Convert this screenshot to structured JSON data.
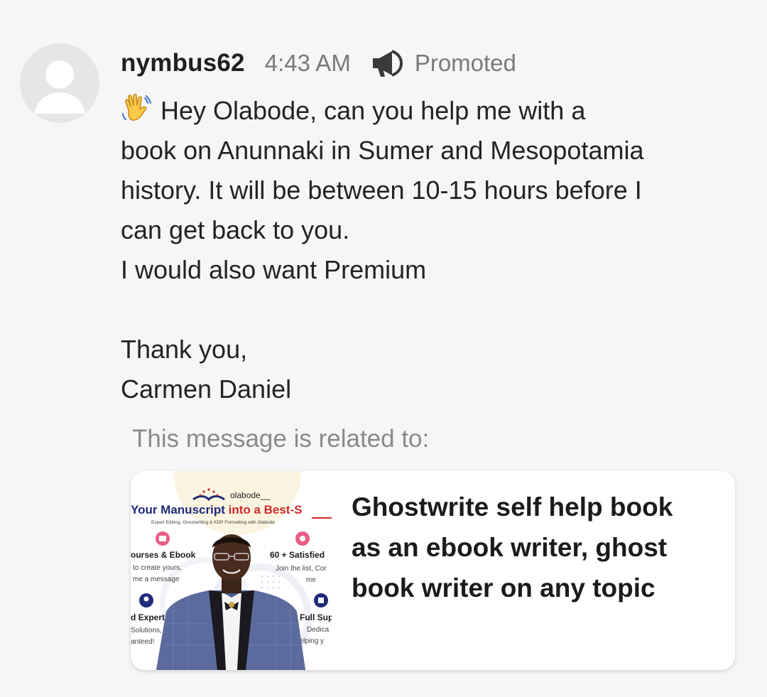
{
  "post": {
    "username": "nymbus62",
    "time": "4:43 AM",
    "promoted_label": "Promoted",
    "promo_icon": "megaphone-icon",
    "avatar_icon": "default-user-avatar"
  },
  "message": {
    "emoji": "waving-hand",
    "lines": [
      "Hey Olabode, can you help me with a",
      "book on Anunnaki in Sumer and Mesopotamia",
      "history. It will be between 10-15 hours before I",
      "can get back to you.",
      "I would also want Premium",
      "",
      "Thank you,",
      "Carmen Daniel"
    ]
  },
  "related": {
    "label": "This message is related to:",
    "gig": {
      "title_lines": [
        "Ghostwrite self help book",
        "as an ebook writer, ghost",
        "book writer on any topic"
      ],
      "thumbnail": {
        "brand": "olabode__",
        "headline_a": "Your Manuscript ",
        "headline_b": "into a Best-S",
        "subhead": "Expert Editing, Ghostwriting & KDP Formatting with Olabode",
        "left_top_title": "ourses & Ebook",
        "left_top_l1": "to create yours,",
        "left_top_l2": "me a message",
        "right_top_title": "60 + Satisfied",
        "right_top_l1": "Join the list, Cor",
        "right_top_l2": "me",
        "left_bot_title": "d Expert",
        "left_bot_l1": "Solutions,",
        "left_bot_l2": "anteed!",
        "right_bot_title": "Full Sup",
        "right_bot_l1": "Dedica",
        "right_bot_l2": "helping y"
      }
    }
  },
  "colors": {
    "background": "#f6f6f6",
    "meta_text": "#7a7a7e",
    "card_bg": "#ffffff",
    "thumb_navy": "#1f2a7a",
    "thumb_red": "#d02a2a",
    "thumb_pink": "#e95d86"
  }
}
